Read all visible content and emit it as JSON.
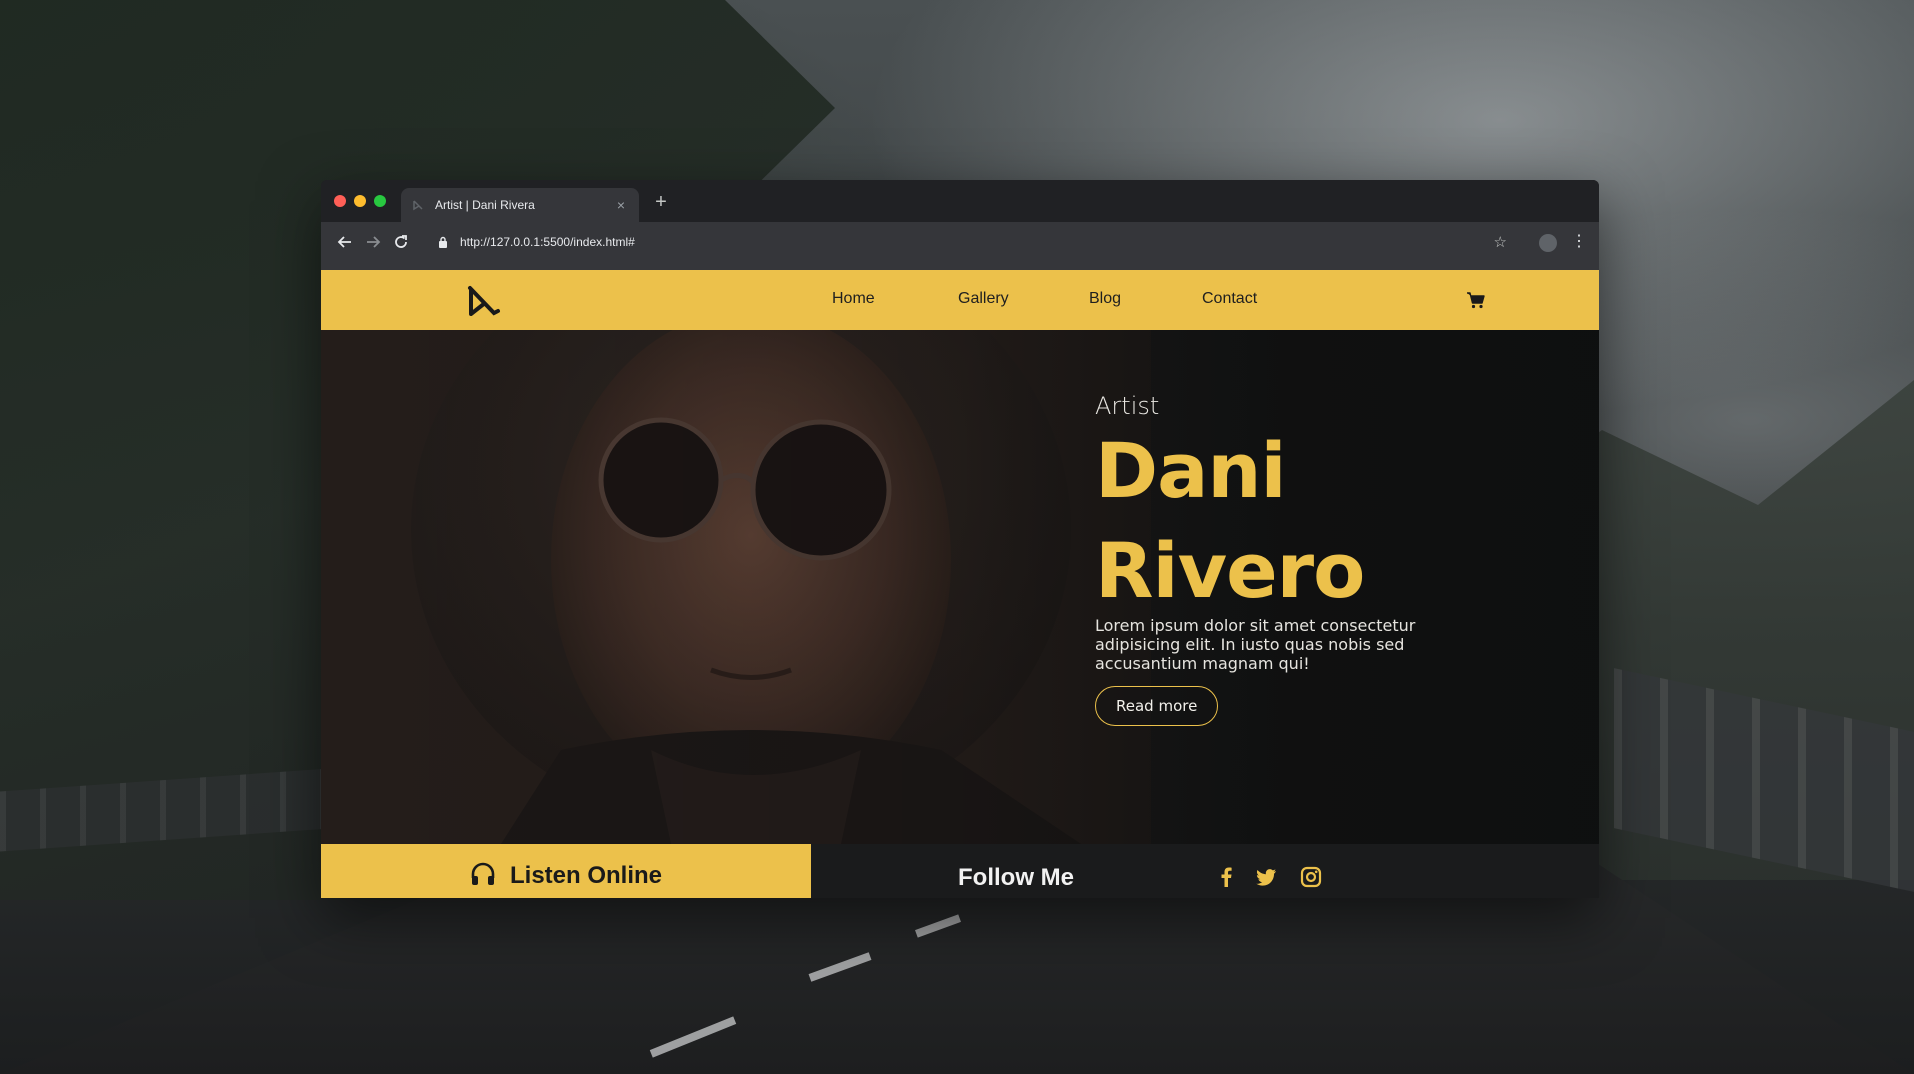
{
  "browser": {
    "tab_title": "Artist | Dani Rivera",
    "tab_close": "×",
    "new_tab": "+",
    "url": "http://127.0.0.1:5500/index.html#",
    "star": "☆",
    "menu": "⋮"
  },
  "nav": {
    "items": [
      "Home",
      "Gallery",
      "Blog",
      "Contact"
    ],
    "logo_icon": "dr-logo-icon",
    "cart_icon": "cart-icon"
  },
  "hero": {
    "subtitle": "Artist",
    "name_line1": "Dani",
    "name_line2": "Rivero",
    "description": "Lorem ipsum dolor sit amet consectetur adipisicing elit. In iusto quas nobis sed accusantium magnam qui!",
    "button": "Read more"
  },
  "footer_bar": {
    "listen_label": "Listen Online",
    "follow_label": "Follow Me",
    "social": [
      "facebook-icon",
      "twitter-icon",
      "instagram-icon"
    ]
  },
  "colors": {
    "accent": "#ecc14b",
    "dark": "#1a1b1c",
    "browser_bg": "#202124",
    "toolbar_bg": "#35363a"
  }
}
